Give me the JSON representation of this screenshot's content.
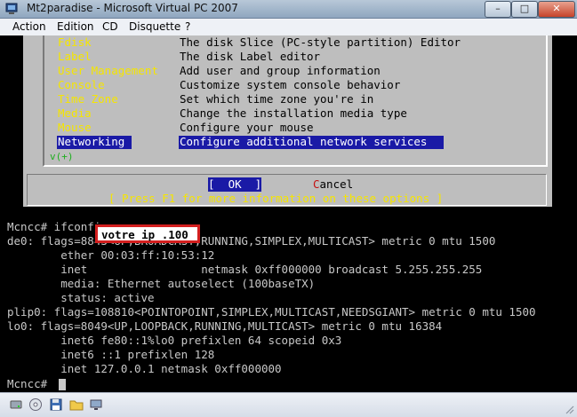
{
  "window": {
    "title": "Mt2paradise - Microsoft Virtual PC 2007",
    "minimize_label": "–",
    "maximize_label": "□",
    "close_label": "✕"
  },
  "menubar": {
    "items": [
      "Action",
      "Edition",
      "CD",
      "Disquette",
      "?"
    ]
  },
  "dialog": {
    "menu_items": [
      {
        "key": "Fdisk",
        "desc": "The disk Slice (PC-style partition) Editor"
      },
      {
        "key": "Label",
        "desc": "The disk Label editor"
      },
      {
        "key": "User Management",
        "desc": "Add user and group information"
      },
      {
        "key": "Console",
        "desc": "Customize system console behavior"
      },
      {
        "key": "Time Zone",
        "desc": "Set which time zone you're in"
      },
      {
        "key": "Media",
        "desc": "Change the installation media type"
      },
      {
        "key": "Mouse",
        "desc": "Configure your mouse"
      },
      {
        "key": "Networking",
        "desc": "Configure additional network services"
      }
    ],
    "selected_index": 7,
    "scroll_indicator": "v(+)",
    "ok_label": "[  OK  ]",
    "cancel_label_first": "C",
    "cancel_label_rest": "ancel",
    "help_hint": "[ Press F1 for more information on these options ]"
  },
  "terminal": {
    "lines": [
      "Mcncc# ifconfig",
      "de0: flags=8843<UP,BROADCAST,RUNNING,SIMPLEX,MULTICAST> metric 0 mtu 1500",
      "        ether 00:03:ff:10:53:12",
      "        inet                 netmask 0xff000000 broadcast 5.255.255.255",
      "        media: Ethernet autoselect (100baseTX)",
      "        status: active",
      "plip0: flags=108810<POINTOPOINT,SIMPLEX,MULTICAST,NEEDSGIANT> metric 0 mtu 1500",
      "lo0: flags=8049<UP,LOOPBACK,RUNNING,MULTICAST> metric 0 mtu 16384",
      "        inet6 fe80::1%lo0 prefixlen 64 scopeid 0x3",
      "        inet6 ::1 prefixlen 128",
      "        inet 127.0.0.1 netmask 0xff000000",
      "",
      "Mcncc# "
    ],
    "ip_annotation": "votre ip .100"
  },
  "colors": {
    "dialog_bg": "#bebebe",
    "menu_key": "#f5e500",
    "menu_desc": "#000000",
    "selection_bg": "#1a1aa6",
    "selection_text": "#ffffff",
    "help_hint": "#f5e500",
    "cancel_hotkey": "#c41010",
    "terminal_text": "#c8c8c8",
    "annotation_border": "#d41f1f"
  },
  "statusbar_icons": [
    "disk-activity-icon",
    "cd-icon",
    "floppy-icon",
    "shared-folder-icon",
    "network-icon"
  ]
}
